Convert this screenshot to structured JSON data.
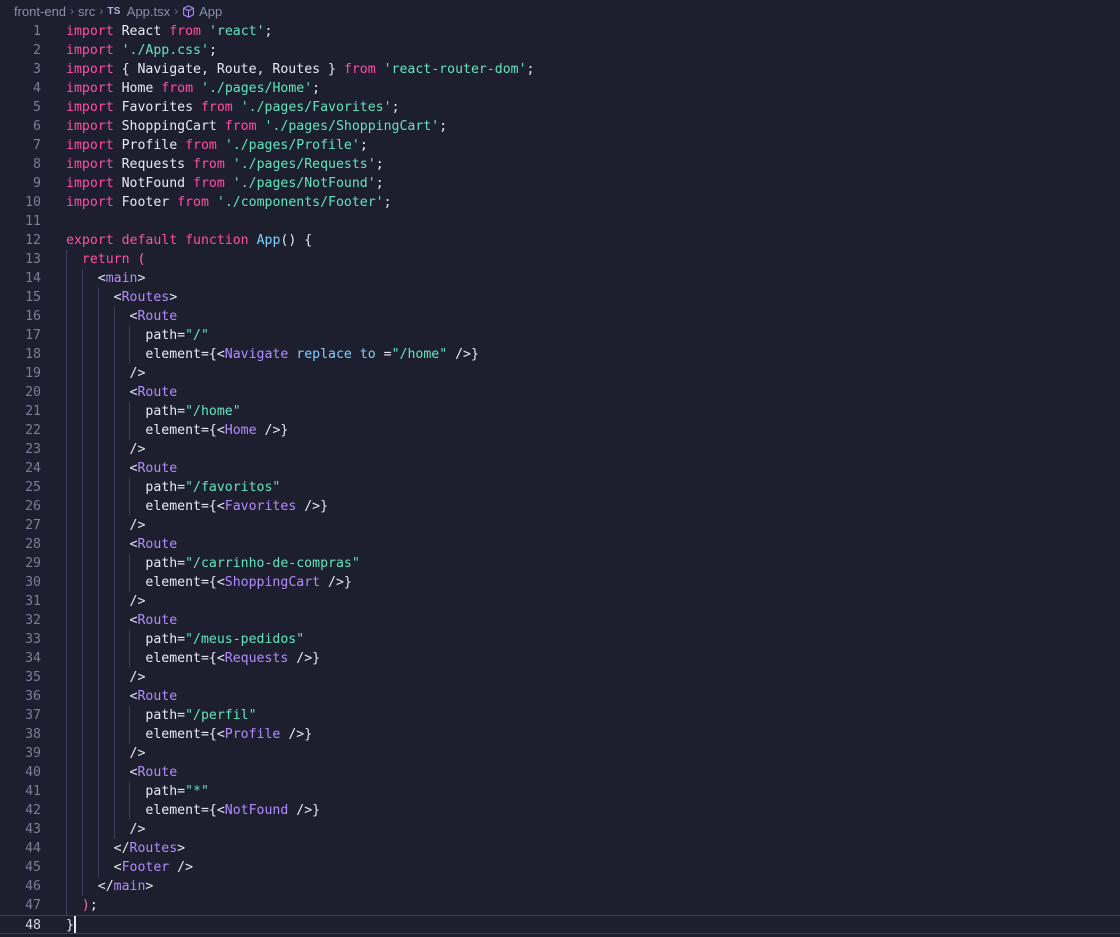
{
  "breadcrumb": {
    "folder1": "front-end",
    "folder2": "src",
    "file_badge": "TS",
    "file": "App.tsx",
    "symbol": "App"
  },
  "lines": [
    {
      "n": "1",
      "t": [
        [
          "kw",
          "import"
        ],
        [
          "plain",
          " React "
        ],
        [
          "kw",
          "from"
        ],
        [
          "plain",
          " "
        ],
        [
          "str",
          "'react'"
        ],
        [
          "plain",
          ";"
        ]
      ]
    },
    {
      "n": "2",
      "t": [
        [
          "kw",
          "import"
        ],
        [
          "plain",
          " "
        ],
        [
          "str",
          "'./App.css'"
        ],
        [
          "plain",
          ";"
        ]
      ]
    },
    {
      "n": "3",
      "t": [
        [
          "kw",
          "import"
        ],
        [
          "plain",
          " { Navigate, Route, Routes } "
        ],
        [
          "kw",
          "from"
        ],
        [
          "plain",
          " "
        ],
        [
          "str",
          "'react-router-dom'"
        ],
        [
          "plain",
          ";"
        ]
      ]
    },
    {
      "n": "4",
      "t": [
        [
          "kw",
          "import"
        ],
        [
          "plain",
          " Home "
        ],
        [
          "kw",
          "from"
        ],
        [
          "plain",
          " "
        ],
        [
          "str",
          "'./pages/Home'"
        ],
        [
          "plain",
          ";"
        ]
      ]
    },
    {
      "n": "5",
      "t": [
        [
          "kw",
          "import"
        ],
        [
          "plain",
          " Favorites "
        ],
        [
          "kw",
          "from"
        ],
        [
          "plain",
          " "
        ],
        [
          "str",
          "'./pages/Favorites'"
        ],
        [
          "plain",
          ";"
        ]
      ]
    },
    {
      "n": "6",
      "t": [
        [
          "kw",
          "import"
        ],
        [
          "plain",
          " ShoppingCart "
        ],
        [
          "kw",
          "from"
        ],
        [
          "plain",
          " "
        ],
        [
          "str",
          "'./pages/ShoppingCart'"
        ],
        [
          "plain",
          ";"
        ]
      ]
    },
    {
      "n": "7",
      "t": [
        [
          "kw",
          "import"
        ],
        [
          "plain",
          " Profile "
        ],
        [
          "kw",
          "from"
        ],
        [
          "plain",
          " "
        ],
        [
          "str",
          "'./pages/Profile'"
        ],
        [
          "plain",
          ";"
        ]
      ]
    },
    {
      "n": "8",
      "t": [
        [
          "kw",
          "import"
        ],
        [
          "plain",
          " Requests "
        ],
        [
          "kw",
          "from"
        ],
        [
          "plain",
          " "
        ],
        [
          "str",
          "'./pages/Requests'"
        ],
        [
          "plain",
          ";"
        ]
      ]
    },
    {
      "n": "9",
      "t": [
        [
          "kw",
          "import"
        ],
        [
          "plain",
          " NotFound "
        ],
        [
          "kw",
          "from"
        ],
        [
          "plain",
          " "
        ],
        [
          "str",
          "'./pages/NotFound'"
        ],
        [
          "plain",
          ";"
        ]
      ]
    },
    {
      "n": "10",
      "t": [
        [
          "kw",
          "import"
        ],
        [
          "plain",
          " Footer "
        ],
        [
          "kw",
          "from"
        ],
        [
          "plain",
          " "
        ],
        [
          "str",
          "'./components/Footer'"
        ],
        [
          "plain",
          ";"
        ]
      ]
    },
    {
      "n": "11",
      "t": []
    },
    {
      "n": "12",
      "t": [
        [
          "kw",
          "export default function"
        ],
        [
          "plain",
          " "
        ],
        [
          "fn",
          "App"
        ],
        [
          "plain",
          "() {"
        ]
      ]
    },
    {
      "n": "13",
      "t": [
        [
          "plain",
          "  "
        ],
        [
          "kw",
          "return"
        ],
        [
          "plain",
          " "
        ],
        [
          "brc",
          "("
        ]
      ]
    },
    {
      "n": "14",
      "t": [
        [
          "plain",
          "    <"
        ],
        [
          "tag",
          "main"
        ],
        [
          "plain",
          ">"
        ]
      ]
    },
    {
      "n": "15",
      "t": [
        [
          "plain",
          "      <"
        ],
        [
          "tag",
          "Routes"
        ],
        [
          "plain",
          ">"
        ]
      ]
    },
    {
      "n": "16",
      "t": [
        [
          "plain",
          "        <"
        ],
        [
          "tag",
          "Route"
        ]
      ]
    },
    {
      "n": "17",
      "t": [
        [
          "plain",
          "          path="
        ],
        [
          "str",
          "\"/\""
        ]
      ]
    },
    {
      "n": "18",
      "t": [
        [
          "plain",
          "          element={<"
        ],
        [
          "tag",
          "Navigate"
        ],
        [
          "plain",
          " "
        ],
        [
          "fn",
          "replace"
        ],
        [
          "plain",
          " "
        ],
        [
          "fn",
          "to"
        ],
        [
          "plain",
          " ="
        ],
        [
          "str",
          "\"/home\""
        ],
        [
          "plain",
          " />}"
        ]
      ]
    },
    {
      "n": "19",
      "t": [
        [
          "plain",
          "        />"
        ]
      ]
    },
    {
      "n": "20",
      "t": [
        [
          "plain",
          "        <"
        ],
        [
          "tag",
          "Route"
        ]
      ]
    },
    {
      "n": "21",
      "t": [
        [
          "plain",
          "          path="
        ],
        [
          "str",
          "\"/home\""
        ]
      ]
    },
    {
      "n": "22",
      "t": [
        [
          "plain",
          "          element={<"
        ],
        [
          "tag",
          "Home"
        ],
        [
          "plain",
          " />}"
        ]
      ]
    },
    {
      "n": "23",
      "t": [
        [
          "plain",
          "        />"
        ]
      ]
    },
    {
      "n": "24",
      "t": [
        [
          "plain",
          "        <"
        ],
        [
          "tag",
          "Route"
        ]
      ]
    },
    {
      "n": "25",
      "t": [
        [
          "plain",
          "          path="
        ],
        [
          "str",
          "\"/favoritos\""
        ]
      ]
    },
    {
      "n": "26",
      "t": [
        [
          "plain",
          "          element={<"
        ],
        [
          "tag",
          "Favorites"
        ],
        [
          "plain",
          " />}"
        ]
      ]
    },
    {
      "n": "27",
      "t": [
        [
          "plain",
          "        />"
        ]
      ]
    },
    {
      "n": "28",
      "t": [
        [
          "plain",
          "        <"
        ],
        [
          "tag",
          "Route"
        ]
      ]
    },
    {
      "n": "29",
      "t": [
        [
          "plain",
          "          path="
        ],
        [
          "str",
          "\"/carrinho-de-compras\""
        ]
      ]
    },
    {
      "n": "30",
      "t": [
        [
          "plain",
          "          element={<"
        ],
        [
          "tag",
          "ShoppingCart"
        ],
        [
          "plain",
          " />}"
        ]
      ]
    },
    {
      "n": "31",
      "t": [
        [
          "plain",
          "        />"
        ]
      ]
    },
    {
      "n": "32",
      "t": [
        [
          "plain",
          "        <"
        ],
        [
          "tag",
          "Route"
        ]
      ]
    },
    {
      "n": "33",
      "t": [
        [
          "plain",
          "          path="
        ],
        [
          "str",
          "\"/meus-pedidos\""
        ]
      ]
    },
    {
      "n": "34",
      "t": [
        [
          "plain",
          "          element={<"
        ],
        [
          "tag",
          "Requests"
        ],
        [
          "plain",
          " />}"
        ]
      ]
    },
    {
      "n": "35",
      "t": [
        [
          "plain",
          "        />"
        ]
      ]
    },
    {
      "n": "36",
      "t": [
        [
          "plain",
          "        <"
        ],
        [
          "tag",
          "Route"
        ]
      ]
    },
    {
      "n": "37",
      "t": [
        [
          "plain",
          "          path="
        ],
        [
          "str",
          "\"/perfil\""
        ]
      ]
    },
    {
      "n": "38",
      "t": [
        [
          "plain",
          "          element={<"
        ],
        [
          "tag",
          "Profile"
        ],
        [
          "plain",
          " />}"
        ]
      ]
    },
    {
      "n": "39",
      "t": [
        [
          "plain",
          "        />"
        ]
      ]
    },
    {
      "n": "40",
      "t": [
        [
          "plain",
          "        <"
        ],
        [
          "tag",
          "Route"
        ]
      ]
    },
    {
      "n": "41",
      "t": [
        [
          "plain",
          "          path="
        ],
        [
          "str",
          "\"*\""
        ]
      ]
    },
    {
      "n": "42",
      "t": [
        [
          "plain",
          "          element={<"
        ],
        [
          "tag",
          "NotFound"
        ],
        [
          "plain",
          " />}"
        ]
      ]
    },
    {
      "n": "43",
      "t": [
        [
          "plain",
          "        />"
        ]
      ]
    },
    {
      "n": "44",
      "t": [
        [
          "plain",
          "      </"
        ],
        [
          "tag",
          "Routes"
        ],
        [
          "plain",
          ">"
        ]
      ]
    },
    {
      "n": "45",
      "t": [
        [
          "plain",
          "      <"
        ],
        [
          "tag",
          "Footer"
        ],
        [
          "plain",
          " />"
        ]
      ]
    },
    {
      "n": "46",
      "t": [
        [
          "plain",
          "    </"
        ],
        [
          "tag",
          "main"
        ],
        [
          "plain",
          ">"
        ]
      ]
    },
    {
      "n": "47",
      "t": [
        [
          "plain",
          "  "
        ],
        [
          "brc",
          ")"
        ],
        [
          "plain",
          ";"
        ]
      ]
    },
    {
      "n": "48",
      "t": [
        [
          "plain",
          "}"
        ]
      ]
    }
  ],
  "current_line": "48",
  "colors": {
    "background": "#1e1f2e",
    "keyword": "#ff4fa3",
    "string": "#62e4bf",
    "tag": "#b18cff",
    "function": "#7bd3ff",
    "text": "#e7e9f3"
  }
}
